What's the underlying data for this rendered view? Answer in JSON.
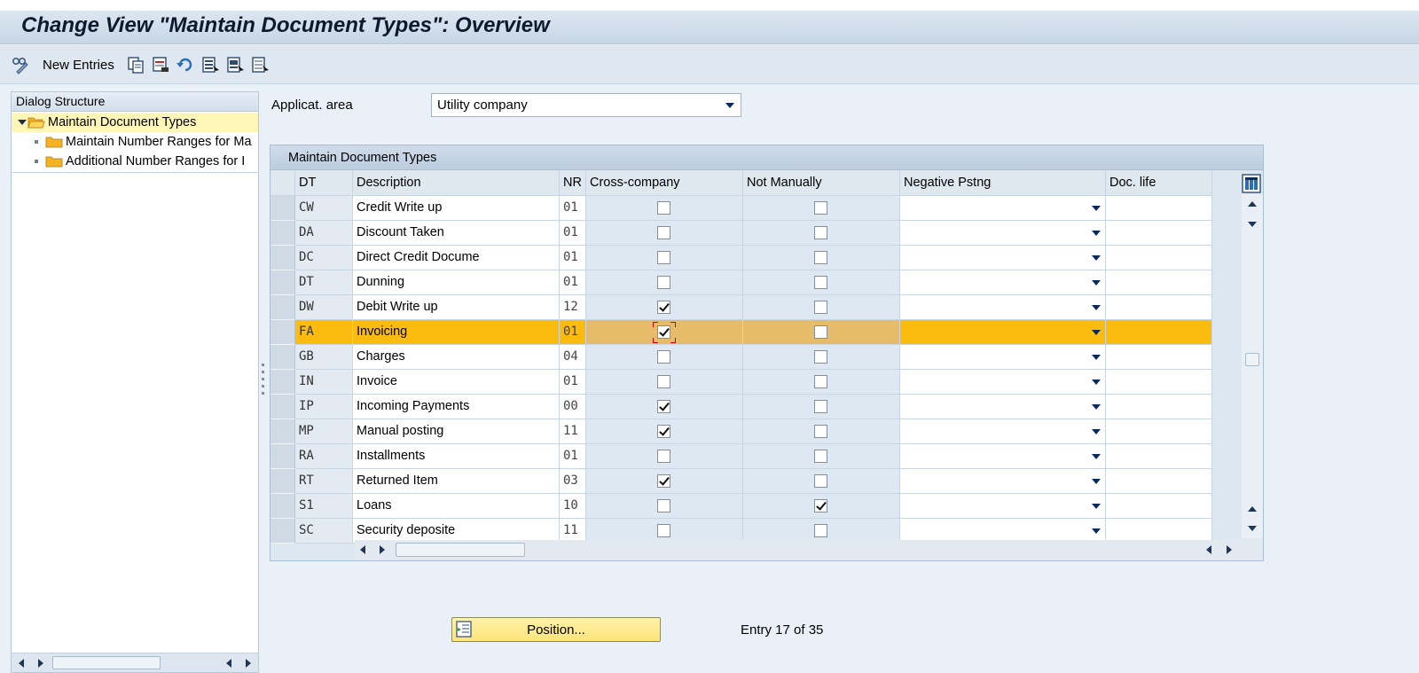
{
  "window": {
    "title": "Change View \"Maintain Document Types\": Overview"
  },
  "toolbar": {
    "new_entries": "New Entries",
    "icons": [
      "display-change-icon",
      "copy-icon",
      "delete-icon",
      "undo-icon",
      "select-all-icon",
      "select-block-icon",
      "deselect-all-icon"
    ]
  },
  "dialog_structure": {
    "title": "Dialog Structure",
    "items": [
      {
        "label": "Maintain Document Types",
        "level": 0,
        "selected": true
      },
      {
        "label": "Maintain Number Ranges for Ma",
        "level": 1
      },
      {
        "label": "Additional Number Ranges for I",
        "level": 1
      }
    ]
  },
  "filter": {
    "label": "Applicat. area",
    "value": "Utility company"
  },
  "table": {
    "title": "Maintain Document Types",
    "columns": [
      "DT",
      "Description",
      "NR",
      "Cross-company",
      "Not Manually",
      "Negative Pstng",
      "Doc. life"
    ],
    "rows": [
      {
        "dt": "CW",
        "desc": "Credit Write up",
        "nr": "01",
        "cross": false,
        "notman": false
      },
      {
        "dt": "DA",
        "desc": "Discount Taken",
        "nr": "01",
        "cross": false,
        "notman": false
      },
      {
        "dt": "DC",
        "desc": "Direct Credit Docume",
        "nr": "01",
        "cross": false,
        "notman": false
      },
      {
        "dt": "DT",
        "desc": "Dunning",
        "nr": "01",
        "cross": false,
        "notman": false
      },
      {
        "dt": "DW",
        "desc": "Debit Write up",
        "nr": "12",
        "cross": true,
        "notman": false
      },
      {
        "dt": "FA",
        "desc": "Invoicing",
        "nr": "01",
        "cross": true,
        "notman": false,
        "selected": true
      },
      {
        "dt": "GB",
        "desc": "Charges",
        "nr": "04",
        "cross": false,
        "notman": false
      },
      {
        "dt": "IN",
        "desc": "Invoice",
        "nr": "01",
        "cross": false,
        "notman": false
      },
      {
        "dt": "IP",
        "desc": "Incoming Payments",
        "nr": "00",
        "cross": true,
        "notman": false
      },
      {
        "dt": "MP",
        "desc": "Manual posting",
        "nr": "11",
        "cross": true,
        "notman": false
      },
      {
        "dt": "RA",
        "desc": "Installments",
        "nr": "01",
        "cross": false,
        "notman": false
      },
      {
        "dt": "RT",
        "desc": "Returned Item",
        "nr": "03",
        "cross": true,
        "notman": false
      },
      {
        "dt": "S1",
        "desc": "Loans",
        "nr": "10",
        "cross": false,
        "notman": true
      },
      {
        "dt": "SC",
        "desc": "Security deposite",
        "nr": "11",
        "cross": false,
        "notman": false
      }
    ]
  },
  "footer": {
    "position_button": "Position...",
    "entry_text": "Entry 17 of 35"
  },
  "colors": {
    "selected_row": "#fbbb0f",
    "title_text": "#0b1a2c",
    "tree_selected": "#fff6b8"
  }
}
